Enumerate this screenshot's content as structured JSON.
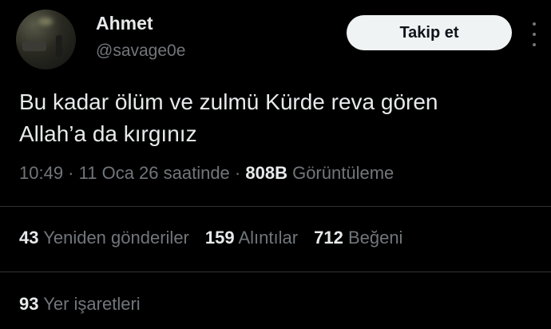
{
  "user": {
    "name": "Ahmet",
    "handle": "@savage0e"
  },
  "follow_button": {
    "label": "Takip et"
  },
  "tweet": {
    "text_line1": "Bu kadar ölüm ve zulmü Kürde reva gören",
    "text_line2": "Allah’a da kırgınız"
  },
  "meta": {
    "time": "10:49",
    "sep1": " · ",
    "date": "11 Oca 26 saatinde",
    "sep2": " · ",
    "views_count": "808B",
    "views_label": "Görüntüleme"
  },
  "stats": {
    "reposts_count": "43",
    "reposts_label": "Yeniden gönderiler",
    "quotes_count": "159",
    "quotes_label": "Alıntılar",
    "likes_count": "712",
    "likes_label": "Beğeni",
    "bookmarks_count": "93",
    "bookmarks_label": "Yer işaretleri"
  },
  "colors": {
    "background": "#000000",
    "text": "#e7e9ea",
    "muted": "#71767b",
    "divider": "#2f3336",
    "button_bg": "#eff3f4"
  }
}
